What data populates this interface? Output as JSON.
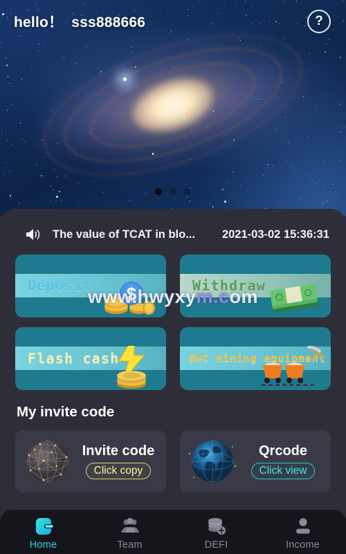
{
  "header": {
    "greeting": "hello！",
    "username": "sss888666",
    "help_icon": "question-circle-icon",
    "help_label": "?"
  },
  "carousel": {
    "slide_count": 3,
    "active_index": 0,
    "image_description": "galaxy"
  },
  "notice": {
    "speaker_icon": "speaker-icon",
    "text": "The value of TCAT in blo...",
    "timestamp": "2021-03-02 15:36:31"
  },
  "actions": [
    {
      "id": "deposit",
      "label": "Deposit",
      "icon": "coins-dollar-icon",
      "text_color": "#57c6e4"
    },
    {
      "id": "withdraw",
      "label": "Withdraw",
      "icon": "cash-stack-icon",
      "text_color": "#5c9d51"
    },
    {
      "id": "flash",
      "label": "Flash cash",
      "icon": "lightning-coins-icon",
      "text_color": "#f2efb0"
    },
    {
      "id": "gwc",
      "label": "GWC mining equipment",
      "icon": "mining-carts-icon",
      "text_color": "#e8c24a"
    }
  ],
  "invite": {
    "section_title": "My invite code",
    "cards": [
      {
        "id": "invite-code",
        "name": "Invite code",
        "action": "Click copy",
        "icon": "network-sphere-icon",
        "accent": "#f4f0a8"
      },
      {
        "id": "qrcode",
        "name": "Qrcode",
        "action": "Click view",
        "icon": "digital-globe-icon",
        "accent": "#49e2e8"
      }
    ]
  },
  "nav": {
    "active": "home",
    "items": [
      {
        "id": "home",
        "label": "Home",
        "icon": "wallet-icon"
      },
      {
        "id": "team",
        "label": "Team",
        "icon": "people-group-icon"
      },
      {
        "id": "defi",
        "label": "DEFI",
        "icon": "coins-plus-icon"
      },
      {
        "id": "income",
        "label": "Income",
        "icon": "person-icon"
      }
    ]
  },
  "watermark": {
    "text": "www.hwyxym.com"
  },
  "colors": {
    "panel_bg": "#2e2e38",
    "card_bg": "#3a3a46",
    "action_bg": "#1e7a8e",
    "nav_bg": "#15151c",
    "accent_cyan": "#27d8e3"
  }
}
